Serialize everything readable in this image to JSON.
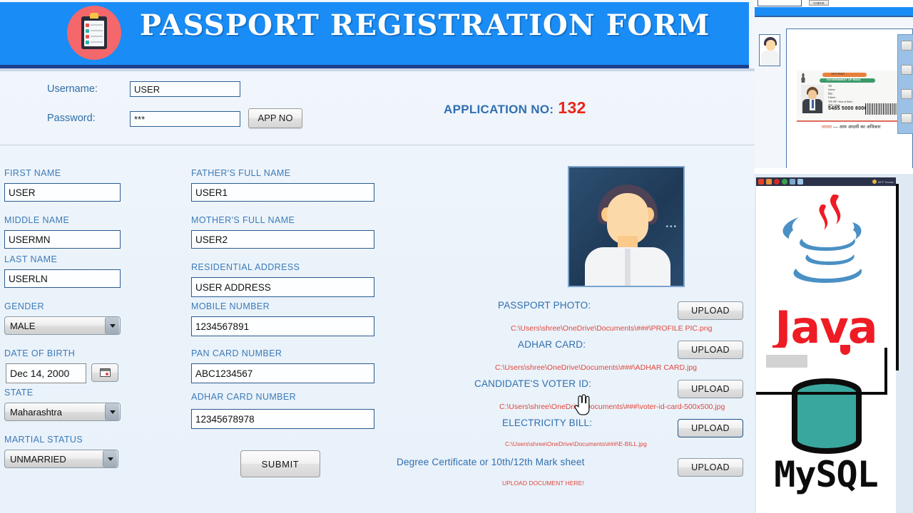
{
  "header": {
    "title": "PASSPORT REGISTRATION FORM",
    "logo_icon": "clipboard-checklist-icon",
    "bg_color": "#1a8cf5"
  },
  "login": {
    "username_label": "Username:",
    "username_value": "USER",
    "password_label": "Password:",
    "password_value": "***",
    "app_no_button": "APP NO",
    "application_label": "APPLICATION NO:",
    "application_number": "132",
    "application_number_color": "#e8251a"
  },
  "form": {
    "left_column": [
      {
        "label": "FIRST NAME",
        "type": "text",
        "value": "USER"
      },
      {
        "label": "MIDDLE NAME",
        "type": "text",
        "value": "USERMN"
      },
      {
        "label": "LAST NAME",
        "type": "text",
        "value": "USERLN"
      },
      {
        "label": "GENDER",
        "type": "select",
        "value": "MALE"
      },
      {
        "label": "DATE OF BIRTH",
        "type": "date",
        "value": "Dec 14, 2000"
      },
      {
        "label": "STATE",
        "type": "select",
        "value": "Maharashtra"
      },
      {
        "label": "MARTIAL STATUS",
        "type": "select",
        "value": "UNMARRIED"
      }
    ],
    "middle_column": [
      {
        "label": "FATHER'S FULL NAME",
        "type": "text",
        "value": "USER1"
      },
      {
        "label": "MOTHER'S FULL NAME",
        "type": "text",
        "value": "USER2"
      },
      {
        "label": "RESIDENTIAL ADDRESS",
        "type": "text",
        "value": "USER ADDRESS"
      },
      {
        "label": "MOBILE NUMBER",
        "type": "text",
        "value": "1234567891"
      },
      {
        "label": "PAN CARD NUMBER",
        "type": "text",
        "value": "ABC1234567"
      },
      {
        "label": "ADHAR CARD NUMBER",
        "type": "text",
        "value": "12345678978"
      }
    ],
    "submit_label": "SUBMIT"
  },
  "uploads": {
    "photo_alt": "passport-photo-preview",
    "rows": [
      {
        "label": "PASSPORT PHOTO:",
        "button": "UPLOAD",
        "path": "C:\\Users\\shree\\OneDrive\\Documents\\###\\PROFILE PIC.png"
      },
      {
        "label": "ADHAR CARD:",
        "button": "UPLOAD",
        "path": "C:\\Users\\shree\\OneDrive\\Documents\\###\\ADHAR CARD.jpg"
      },
      {
        "label": "CANDIDATE'S VOTER ID:",
        "button": "UPLOAD",
        "path": "C:\\Users\\shree\\OneDrive\\Documents\\###\\voter-id-card-500x500.jpg"
      },
      {
        "label": "ELECTRICITY BILL:",
        "button": "UPLOAD",
        "path": "C:\\Users\\shree\\OneDrive\\Documents\\###\\E-BILL.jpg"
      },
      {
        "label": "Degree Certificate or 10th/12th  Mark sheet",
        "button": "UPLOAD",
        "path": "UPLOAD DOCUMENT HERE!"
      }
    ]
  },
  "side_panel": {
    "check_button": "CHECK",
    "aadhaar": {
      "gov_hindi": "भारत सरकार",
      "gov_english": "GOVERNMENT OF INDIA",
      "line1": "नाम",
      "line2": "Name",
      "line3": "पिता :",
      "line4": "Father :",
      "line5": "जन्म वर्ष / Year of Birth :",
      "line6": "पुरुष / Male",
      "number": "5485 5000 8000",
      "footer_orange": "आधार",
      "footer_rest": "— आम आदमी का अधिकार"
    },
    "java_logo_text": "Java",
    "mysql_logo_text": "MySQL",
    "taskbar_weather": "83°F  Smoke",
    "java_color": "#ee1c25",
    "mysql_color": "#3aa79e"
  }
}
